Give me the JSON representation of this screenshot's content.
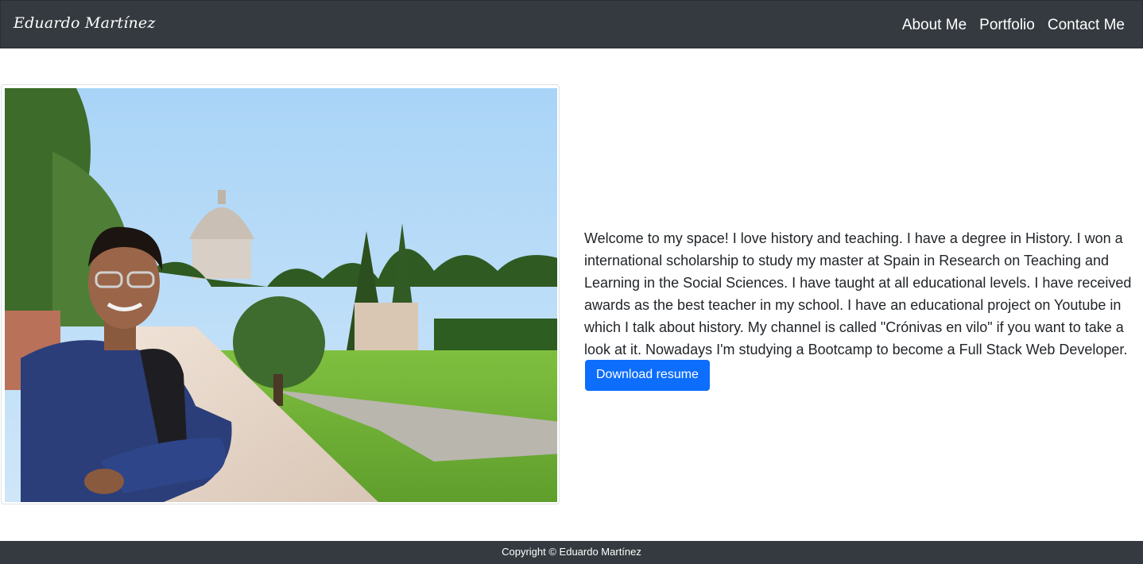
{
  "navbar": {
    "brand": "Eduardo Martínez",
    "links": [
      {
        "label": "About Me"
      },
      {
        "label": "Portfolio"
      },
      {
        "label": "Contact Me"
      }
    ]
  },
  "hero": {
    "image_alt": "Photo of Eduardo Martínez in the Vatican gardens",
    "intro_text": "Welcome to my space! I love history and teaching. I have a degree in History. I won a international scholarship to study my master at Spain in Research on Teaching and Learning in the Social Sciences. I have taught at all educational levels. I have received awards as the best teacher in my school. I have an educational project on Youtube in which I talk about history. My channel is called \"Crónivas en vilo\" if you want to take a look at it. Nowadays I'm studying a Bootcamp to become a Full Stack Web Developer.",
    "resume_button": "Download resume"
  },
  "footer": {
    "copyright": "Copyright © Eduardo Martínez"
  },
  "colors": {
    "navbar_bg": "#343a40",
    "button_primary": "#0d6efd",
    "text": "#212529"
  }
}
